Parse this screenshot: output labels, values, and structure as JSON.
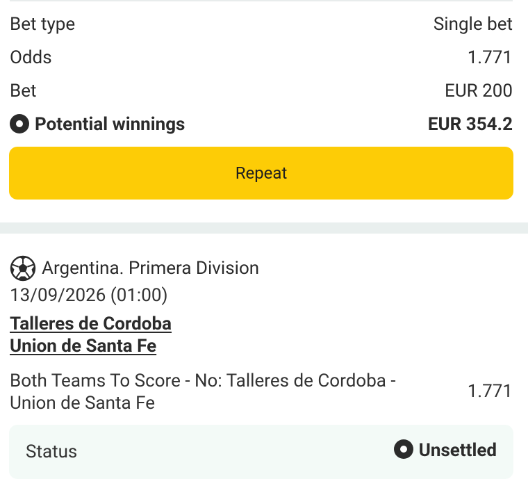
{
  "summary": {
    "bet_type_label": "Bet type",
    "bet_type_value": "Single bet",
    "odds_label": "Odds",
    "odds_value": "1.771",
    "bet_label": "Bet",
    "bet_value": "EUR 200",
    "winnings_label": "Potential winnings",
    "winnings_value": "EUR 354.2",
    "winnings_icon": "status-dot-icon"
  },
  "repeat_button": {
    "label": "Repeat",
    "color": "#fdcc06"
  },
  "event": {
    "sport_icon": "soccer-ball-icon",
    "league": "Argentina. Primera Division",
    "datetime": "13/09/2026 (01:00)",
    "home_team": "Talleres de Cordoba",
    "away_team": "Union de Santa Fe",
    "market": "Both Teams To Score - No: Talleres de Cordoba - Union de Santa Fe",
    "odds": "1.771"
  },
  "status": {
    "label": "Status",
    "value": "Unsettled",
    "icon": "status-dot-icon"
  },
  "colors": {
    "accent": "#fdcc06",
    "separator": "#e9efee",
    "status_bg": "#f3faf7"
  }
}
